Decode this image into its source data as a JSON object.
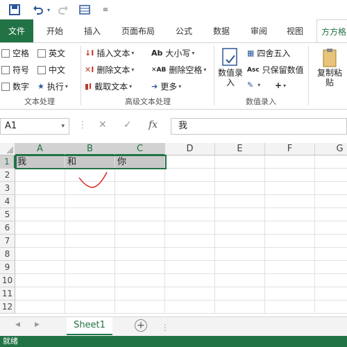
{
  "qat": {
    "save": "save-icon",
    "undo": "undo-icon",
    "redo": "redo-icon",
    "form": "form-icon",
    "customize": "customize-icon"
  },
  "tabs": [
    "文件",
    "开始",
    "插入",
    "页面布局",
    "公式",
    "数据",
    "审阅",
    "视图",
    "方方格"
  ],
  "active_tab": "方方格",
  "ribbon": {
    "text_proc": {
      "items": [
        "空格",
        "英文",
        "符号",
        "中文",
        "数字",
        "执行"
      ],
      "label": "文本处理"
    },
    "adv_text": {
      "items": [
        "插入文本",
        "删除文本",
        "截取文本",
        "大小写",
        "删除空格",
        "更多"
      ],
      "label": "高级文本处理"
    },
    "num_input": {
      "big_button": "数值录入",
      "items": [
        "四舍五入",
        "只保留数值"
      ],
      "label": "数值录入"
    },
    "copy_paste": "复制粘贴"
  },
  "formula_bar": {
    "name_box": "A1",
    "fx": "fx",
    "value": "我"
  },
  "columns": [
    "A",
    "B",
    "C",
    "D",
    "E",
    "F",
    "G"
  ],
  "rows": [
    "1",
    "2",
    "3",
    "4",
    "5",
    "6",
    "7",
    "8",
    "9",
    "10",
    "11",
    "12"
  ],
  "cells": {
    "A1": "我",
    "B1": "和",
    "C1": "你"
  },
  "sheet_tab": "Sheet1",
  "status": "就绪",
  "colors": {
    "excel_green": "#217346",
    "annotation_red": "#d22"
  }
}
